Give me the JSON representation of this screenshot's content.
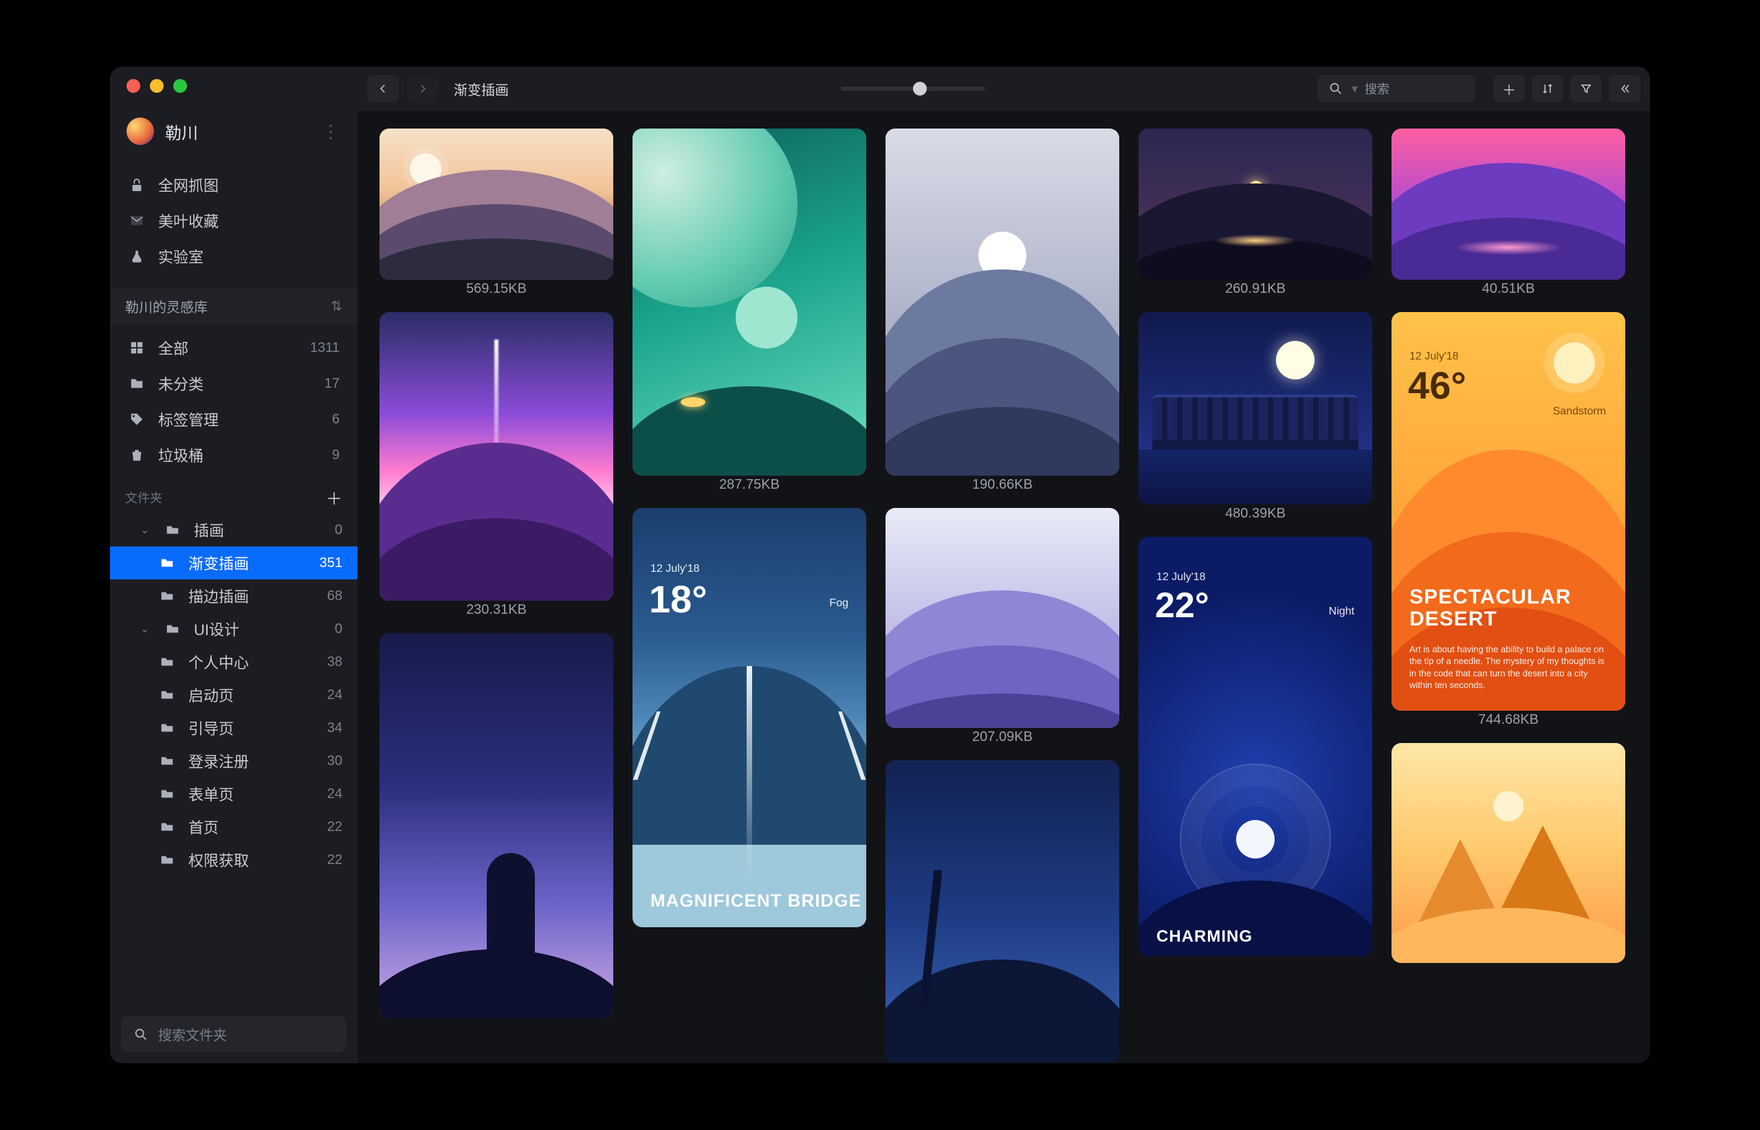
{
  "user": {
    "name": "勒川"
  },
  "nav": [
    {
      "icon": "grab",
      "label": "全网抓图"
    },
    {
      "icon": "mail",
      "label": "美叶收藏"
    },
    {
      "icon": "flask",
      "label": "实验室"
    }
  ],
  "librarySwitcher": "勒川的灵感库",
  "library": [
    {
      "icon": "grid",
      "label": "全部",
      "count": "1311"
    },
    {
      "icon": "folder",
      "label": "未分类",
      "count": "17"
    },
    {
      "icon": "tag",
      "label": "标签管理",
      "count": "6"
    },
    {
      "icon": "trash",
      "label": "垃圾桶",
      "count": "9"
    }
  ],
  "foldersHeader": "文件夹",
  "folders": [
    {
      "depth": 1,
      "expandable": true,
      "label": "插画",
      "count": "0"
    },
    {
      "depth": 2,
      "expandable": false,
      "label": "渐变插画",
      "count": "351",
      "active": true
    },
    {
      "depth": 2,
      "expandable": false,
      "label": "描边插画",
      "count": "68"
    },
    {
      "depth": 1,
      "expandable": true,
      "label": "UI设计",
      "count": "0"
    },
    {
      "depth": 2,
      "expandable": false,
      "label": "个人中心",
      "count": "38"
    },
    {
      "depth": 2,
      "expandable": false,
      "label": "启动页",
      "count": "24"
    },
    {
      "depth": 2,
      "expandable": false,
      "label": "引导页",
      "count": "34"
    },
    {
      "depth": 2,
      "expandable": false,
      "label": "登录注册",
      "count": "30"
    },
    {
      "depth": 2,
      "expandable": false,
      "label": "表单页",
      "count": "24"
    },
    {
      "depth": 2,
      "expandable": false,
      "label": "首页",
      "count": "22"
    },
    {
      "depth": 2,
      "expandable": false,
      "label": "权限获取",
      "count": "22"
    }
  ],
  "sidebarSearchPlaceholder": "搜索文件夹",
  "toolbar": {
    "breadcrumb": "渐变插画",
    "searchPlaceholder": "搜索"
  },
  "cards": {
    "c1_size": "569.15KB",
    "c2_size": "230.31KB",
    "c4_size": "287.75KB",
    "c5_date": "12 July'18",
    "c5_temp": "18°",
    "c5_cond": "Fog",
    "c5_title": "MAGNIFICENT BRIDGE",
    "c6_size": "190.66KB",
    "c7_size": "207.09KB",
    "c8_size": "260.91KB",
    "c9_size": "480.39KB",
    "c10_date": "12 July'18",
    "c10_temp": "22°",
    "c10_cond": "Night",
    "c10_title": "CHARMING",
    "c11_size": "40.51KB",
    "c12_date": "12 July'18",
    "c12_temp": "46°",
    "c12_cond": "Sandstorm",
    "c12_title": "SPECTACULAR DESERT",
    "c12_body": "Art is about having the ability to build a palace on the tip of a needle. The mystery of my thoughts is in the code that can turn the desert into a city within ten seconds.",
    "c12_size": "744.68KB"
  }
}
